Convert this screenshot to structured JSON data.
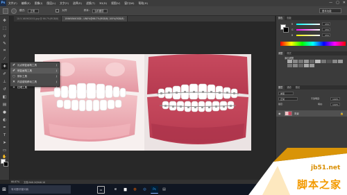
{
  "app": {
    "logo": "Ps"
  },
  "menu": [
    "文件(F)",
    "编辑(E)",
    "图像(I)",
    "图层(L)",
    "文字(Y)",
    "选择(S)",
    "滤镜(T)",
    "3D(D)",
    "视图(V)",
    "窗口(W)",
    "帮助(H)"
  ],
  "window_controls": [
    "—",
    "▢",
    "✕"
  ],
  "options": {
    "mode_label": "模式:",
    "mode_value": "正常",
    "aligned": "对齐",
    "sample_label": "样本:",
    "sample_value": "当前图层",
    "workspace": "基本功能"
  },
  "tabs": [
    "1X.5.160902001.jpg @ 66.7%(RGB/8)",
    "1INWUNI4OXDI…UN0%@66.7%(RGB/8) 100%(RGB/8)"
  ],
  "flyout": [
    {
      "label": "污点修复画笔工具",
      "key": "J",
      "icon": "spot-healing-brush-icon"
    },
    {
      "label": "修复画笔工具",
      "key": "J",
      "icon": "healing-brush-icon"
    },
    {
      "label": "修补工具",
      "key": "J",
      "icon": "patch-icon"
    },
    {
      "label": "内容感知移动工具",
      "key": "J",
      "icon": "content-aware-move-icon"
    },
    {
      "label": "红眼工具",
      "key": "J",
      "icon": "red-eye-icon"
    }
  ],
  "status": {
    "zoom": "66.67%",
    "doc": "文档:946.1K/946.1K"
  },
  "color_panel": {
    "tabs": [
      "颜色",
      "色板"
    ],
    "sliders": [
      {
        "label": "R",
        "value": "255"
      },
      {
        "label": "G",
        "value": "255"
      },
      {
        "label": "B",
        "value": "255"
      }
    ]
  },
  "adjust_panel": {
    "tabs": [
      "调整",
      "样式"
    ],
    "title": "添加调整"
  },
  "layers_panel": {
    "tabs": [
      "图层",
      "通道",
      "路径"
    ],
    "kind": "类型",
    "blend": "正常",
    "opacity_label": "不透明度:",
    "opacity": "100%",
    "lock_label": "锁定:",
    "fill_label": "填充:",
    "fill": "100%",
    "layer_name": "背景"
  },
  "taskbar": {
    "search_placeholder": "有问题尽管问我"
  },
  "watermark": {
    "site": "jb51.net",
    "brand": "脚本之家"
  },
  "colors": {
    "accent": "#2b6fd6",
    "gum_pink": "#e8a0aa",
    "watermark_orange": "#f6a400"
  }
}
